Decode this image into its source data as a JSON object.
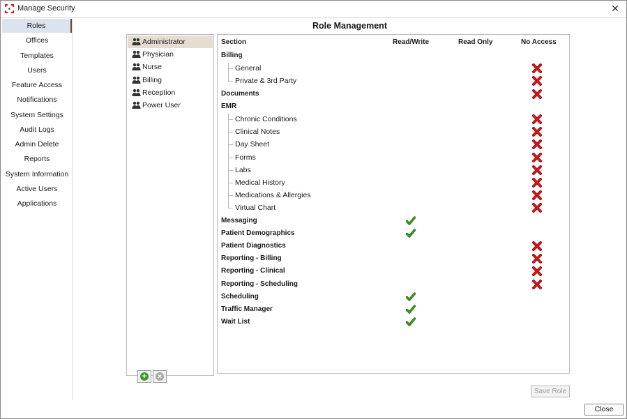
{
  "window": {
    "title": "Manage Security",
    "close_glyph": "✕"
  },
  "sidebar": {
    "items": [
      {
        "label": "Roles",
        "selected": true
      },
      {
        "label": "Offices"
      },
      {
        "label": "Templates"
      },
      {
        "label": "Users"
      },
      {
        "label": "Feature Access"
      },
      {
        "label": "Notifications"
      },
      {
        "label": "System Settings"
      },
      {
        "label": "Audit Logs"
      },
      {
        "label": "Admin Delete"
      },
      {
        "label": "Reports"
      },
      {
        "label": "System Information"
      },
      {
        "label": "Active Users"
      },
      {
        "label": "Applications"
      }
    ]
  },
  "main": {
    "title": "Role Management"
  },
  "roles": {
    "icon": "users-icon",
    "items": [
      {
        "label": "Administrator",
        "selected": true
      },
      {
        "label": "Physician"
      },
      {
        "label": "Nurse"
      },
      {
        "label": "Billing"
      },
      {
        "label": "Reception"
      },
      {
        "label": "Power User"
      }
    ],
    "add_icon": "plus-circle-icon",
    "remove_icon": "x-circle-icon"
  },
  "permissions": {
    "headers": {
      "section": "Section",
      "read_write": "Read/Write",
      "read_only": "Read Only",
      "no_access": "No Access"
    },
    "rows": [
      {
        "label": "Billing",
        "level": 0,
        "access": ""
      },
      {
        "label": "General",
        "level": 1,
        "access": "no_access"
      },
      {
        "label": "Private & 3rd Party",
        "level": 1,
        "access": "no_access",
        "last": true
      },
      {
        "label": "Documents",
        "level": 0,
        "access": "no_access"
      },
      {
        "label": "EMR",
        "level": 0,
        "access": ""
      },
      {
        "label": "Chronic Conditions",
        "level": 1,
        "access": "no_access"
      },
      {
        "label": "Clinical Notes",
        "level": 1,
        "access": "no_access"
      },
      {
        "label": "Day Sheet",
        "level": 1,
        "access": "no_access"
      },
      {
        "label": "Forms",
        "level": 1,
        "access": "no_access"
      },
      {
        "label": "Labs",
        "level": 1,
        "access": "no_access"
      },
      {
        "label": "Medical History",
        "level": 1,
        "access": "no_access"
      },
      {
        "label": "Medications & Allergies",
        "level": 1,
        "access": "no_access"
      },
      {
        "label": "Virtual Chart",
        "level": 1,
        "access": "no_access",
        "last": true
      },
      {
        "label": "Messaging",
        "level": 0,
        "access": "read_write"
      },
      {
        "label": "Patient Demographics",
        "level": 0,
        "access": "read_write"
      },
      {
        "label": "Patient Diagnostics",
        "level": 0,
        "access": "no_access"
      },
      {
        "label": "Reporting - Billing",
        "level": 0,
        "access": "no_access"
      },
      {
        "label": "Reporting - Clinical",
        "level": 0,
        "access": "no_access"
      },
      {
        "label": "Reporting - Scheduling",
        "level": 0,
        "access": "no_access"
      },
      {
        "label": "Scheduling",
        "level": 0,
        "access": "read_write"
      },
      {
        "label": "Traffic Manager",
        "level": 0,
        "access": "read_write"
      },
      {
        "label": "Wait List",
        "level": 0,
        "access": "read_write"
      }
    ],
    "check_icon": "check-icon",
    "deny_icon": "red-x-icon"
  },
  "footer": {
    "save_role": "Save Role",
    "close": "Close"
  },
  "colors": {
    "accent": "#6d4a33",
    "selected_nav": "#dbe3ee",
    "selected_role": "#e6dcd2",
    "check": "#3c9a1f",
    "deny": "#d0181c"
  }
}
